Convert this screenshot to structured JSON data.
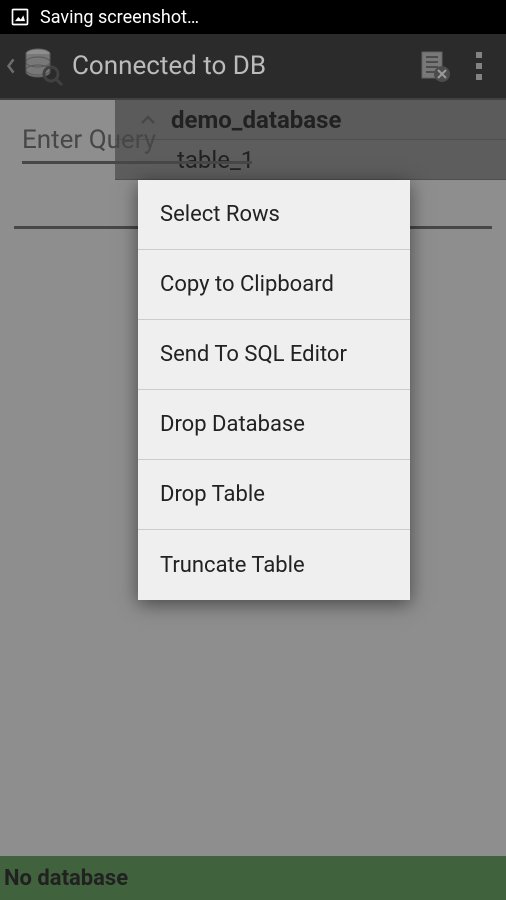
{
  "statusBar": {
    "text": "Saving screenshot…"
  },
  "actionBar": {
    "title": "Connected to DB"
  },
  "dbPanel": {
    "database": "demo_database",
    "table": "table_1"
  },
  "queryInput": {
    "placeholder": "Enter Query"
  },
  "bottomBar": {
    "text": "No database"
  },
  "contextMenu": {
    "items": [
      "Select Rows",
      "Copy to Clipboard",
      "Send To SQL Editor",
      "Drop Database",
      "Drop Table",
      "Truncate Table"
    ]
  }
}
